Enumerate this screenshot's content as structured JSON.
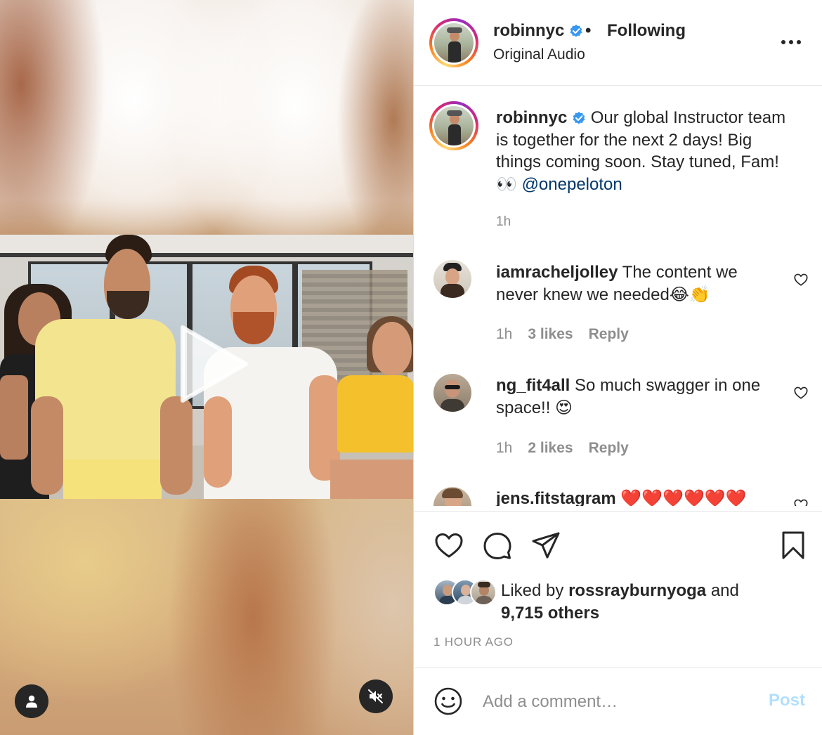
{
  "post": {
    "author": "robinnyc",
    "follow_status": "Following",
    "separator": "•",
    "audio": "Original Audio",
    "caption_text": "Our global Instructor team is together for the next 2 days! Big things coming soon. Stay tuned, Fam! 👀",
    "caption_mention": "@onepeloton",
    "caption_time": "1h"
  },
  "comments": [
    {
      "user": "iamracheljolley",
      "text": "The content we never knew we needed😂👏",
      "time": "1h",
      "likes": "3 likes",
      "reply": "Reply"
    },
    {
      "user": "ng_fit4all",
      "text": "So much swagger in one space!! 😍",
      "time": "1h",
      "likes": "2 likes",
      "reply": "Reply"
    },
    {
      "user": "jens.fitstagram",
      "text": "❤️❤️❤️❤️❤️❤️"
    }
  ],
  "likes": {
    "prefix": "Liked by",
    "user": "rossrayburnyoga",
    "joiner": "and",
    "others": "9,715 others"
  },
  "timestamp": "1 HOUR AGO",
  "comment_box": {
    "placeholder": "Add a comment…",
    "post_label": "Post"
  },
  "colors": {
    "verified": "#3897f0",
    "mention": "#00376b",
    "post_disabled": "#b2dffc",
    "muted_text": "#8e8e8e"
  },
  "icons": [
    "play-icon",
    "user-icon",
    "muted-speaker-icon",
    "more-icon",
    "verified-icon",
    "heart-icon",
    "comment-icon",
    "share-icon",
    "bookmark-icon",
    "emoji-icon"
  ]
}
